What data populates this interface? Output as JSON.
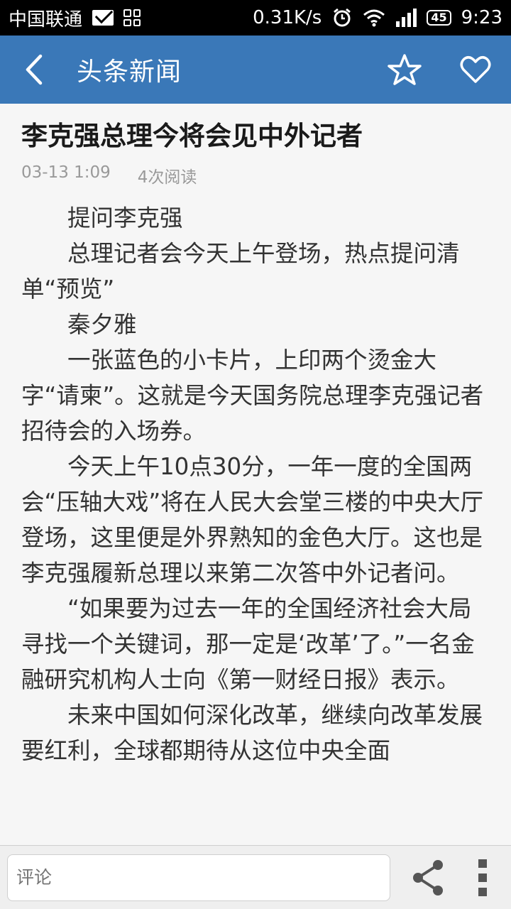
{
  "status_bar": {
    "carrier": "中国联通",
    "speed": "0.31K/s",
    "battery": "45",
    "time": "9:23"
  },
  "header": {
    "title": "头条新闻",
    "back_icon": "chevron-left-icon",
    "favorite_icon": "star-icon",
    "like_icon": "heart-icon"
  },
  "article": {
    "title": "李克强总理今将会见中外记者",
    "date": "03-13 1:09",
    "reads": "4次阅读",
    "paragraphs": [
      "提问李克强",
      "总理记者会今天上午登场，热点提问清单“预览”",
      "秦夕雅",
      "一张蓝色的小卡片，上印两个烫金大字“请柬”。这就是今天国务院总理李克强记者招待会的入场券。",
      "今天上午10点30分，一年一度的全国两会“压轴大戏”将在人民大会堂三楼的中央大厅登场，这里便是外界熟知的金色大厅。这也是李克强履新总理以来第二次答中外记者问。",
      "“如果要为过去一年的全国经济社会大局寻找一个关键词，那一定是‘改革’了。”一名金融研究机构人士向《第一财经日报》表示。",
      "未来中国如何深化改革，继续向改革发展要红利，全球都期待从这位中央全面"
    ]
  },
  "bottom_bar": {
    "comment_placeholder": "评论",
    "share_icon": "share-icon",
    "more_icon": "more-vertical-icon"
  }
}
